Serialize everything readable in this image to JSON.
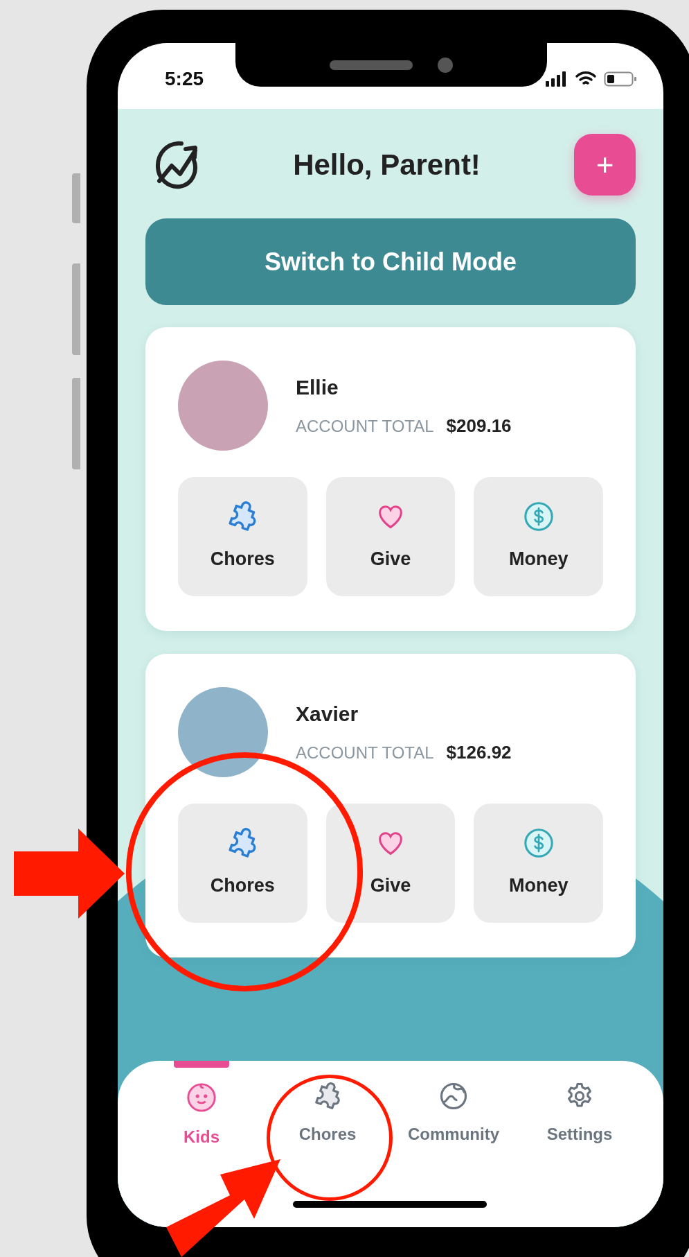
{
  "status_bar": {
    "time": "5:25"
  },
  "header": {
    "title": "Hello, Parent!",
    "add_button": "+"
  },
  "mode_button": "Switch to Child Mode",
  "kids": [
    {
      "name": "Ellie",
      "account_label": "ACCOUNT TOTAL",
      "total": "$209.16",
      "actions": [
        {
          "kind": "chores",
          "label": "Chores"
        },
        {
          "kind": "give",
          "label": "Give"
        },
        {
          "kind": "money",
          "label": "Money"
        }
      ]
    },
    {
      "name": "Xavier",
      "account_label": "ACCOUNT TOTAL",
      "total": "$126.92",
      "actions": [
        {
          "kind": "chores",
          "label": "Chores"
        },
        {
          "kind": "give",
          "label": "Give"
        },
        {
          "kind": "money",
          "label": "Money"
        }
      ]
    }
  ],
  "tab_bar": [
    {
      "kind": "kids",
      "label": "Kids",
      "selected": true
    },
    {
      "kind": "chores",
      "label": "Chores",
      "selected": false
    },
    {
      "kind": "community",
      "label": "Community",
      "selected": false
    },
    {
      "kind": "settings",
      "label": "Settings",
      "selected": false
    }
  ]
}
